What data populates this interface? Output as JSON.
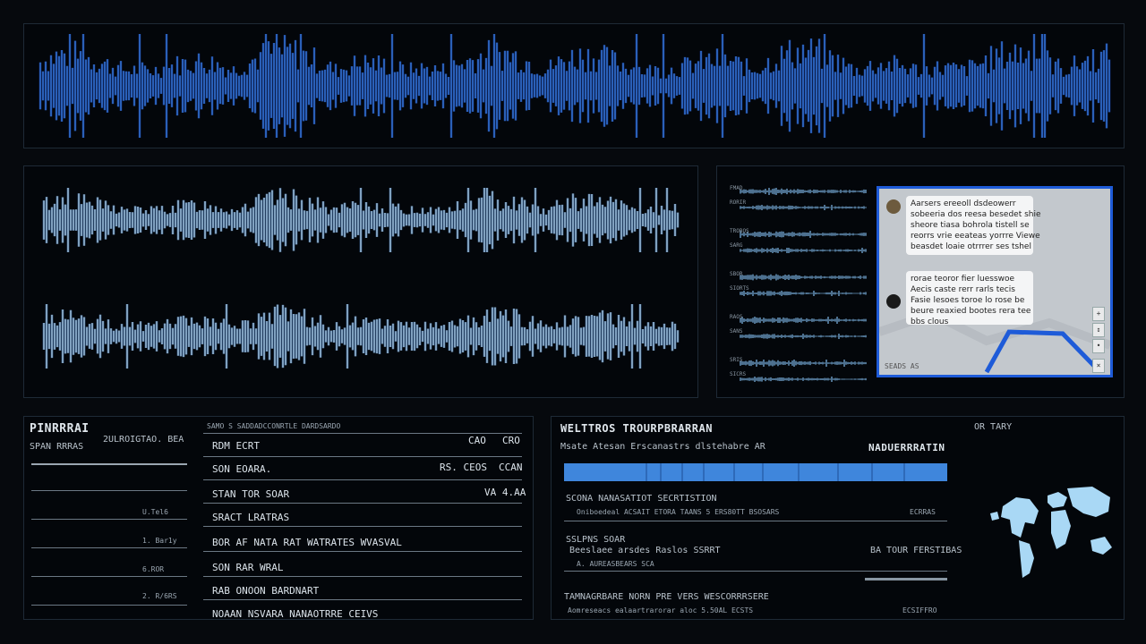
{
  "colors": {
    "background": "#06090d",
    "panel": "#03060a",
    "panel_border": "#1e2a36",
    "wave_blue": "#3f8cff",
    "wave_light": "#bfe3ff",
    "accent_blue": "#1e5bd8",
    "map_blue": "#a9d8f5"
  },
  "left_table": {
    "title": "PINRRRAI",
    "subtitle": "SPAN RRRAS",
    "left_header_right": "2ULROIGTAO. BEA",
    "mini_rows": [
      "U.Tel6",
      "1. Bar1y",
      "6.ROR",
      "2. R/6RS"
    ],
    "header": "SAMO S SADDADCCONRTLE DARDSARDO",
    "rows": [
      {
        "label": "RDM ECRT",
        "values": [
          "CAO",
          "CRO"
        ]
      },
      {
        "label": "SON EOARA.",
        "values": [
          "RS. CEOS",
          "CCAN"
        ]
      },
      {
        "label": "STAN TOR SOAR",
        "values": [
          "VA 4.AA"
        ]
      },
      {
        "label": "SRACT LRATRAS",
        "values": []
      },
      {
        "label": "BOR AF NATA RAT WATRATES WVASVAL",
        "values": []
      },
      {
        "label": "SON RAR WRAL",
        "values": []
      },
      {
        "label": "RAB ONOON BARDNART",
        "values": []
      },
      {
        "label": "NOAAN NSVARA NANAOTRRE CEIVS",
        "values": []
      }
    ]
  },
  "right_table": {
    "title": "WELTTROS TROURPBRARRAN",
    "right_label": "OR TARY",
    "subheader_left": "Msate Atesan Erscanastrs dlstehabre AR",
    "subheader_right": "NADUERRRATIN",
    "sections": [
      {
        "heading": "SCONA NANASATIOT SECRTISTION",
        "line": "Oniboedeal ACSAIT ETORA TAANS 5 ERS80TT BSOSARS",
        "value": "ECRRAS"
      },
      {
        "heading": "SSLPNS SOAR",
        "line": "Beeslaee arsdes Raslos SSRRT",
        "sub": "A. AUREASBEARS SCA",
        "value": "BA TOUR FERSTIBAS"
      },
      {
        "heading": "TAMNAGRBARE NORN PRE VERS WESCORRRSERE",
        "line": "Aomreseacs ealaartrarorar aloc 5.50AL ECSTS",
        "value": "ECSIFFRO"
      }
    ]
  },
  "chat": {
    "messages": [
      {
        "text": "Aarsers ereeoll dsdeowerr\nsobeeria dos reesa besedet shie\nsheore tiasa bohrola tistell se\nreorrs vrie eeateas yorrre Viewe\nbeasdet loaie otrrrer ses tshel"
      },
      {
        "text": "rorae teoror fier luesswoe\nAecis caste rerr rarls tecis\nFasie lesoes toroe lo rose be\nbeure reaxied bootes rera tee\nbbs clous"
      }
    ],
    "side_buttons": [
      "+",
      "↕",
      "•",
      "×"
    ],
    "bottom_caption": "SEADS AS"
  },
  "mini_waves": {
    "labels": [
      "FMAD",
      "RORIR",
      "TROBOS",
      "SARG",
      "SBOR",
      "SIORTS",
      "RAOS",
      "SANS",
      "SRIS",
      "SICRS"
    ]
  },
  "map": {
    "label": "world-map"
  }
}
